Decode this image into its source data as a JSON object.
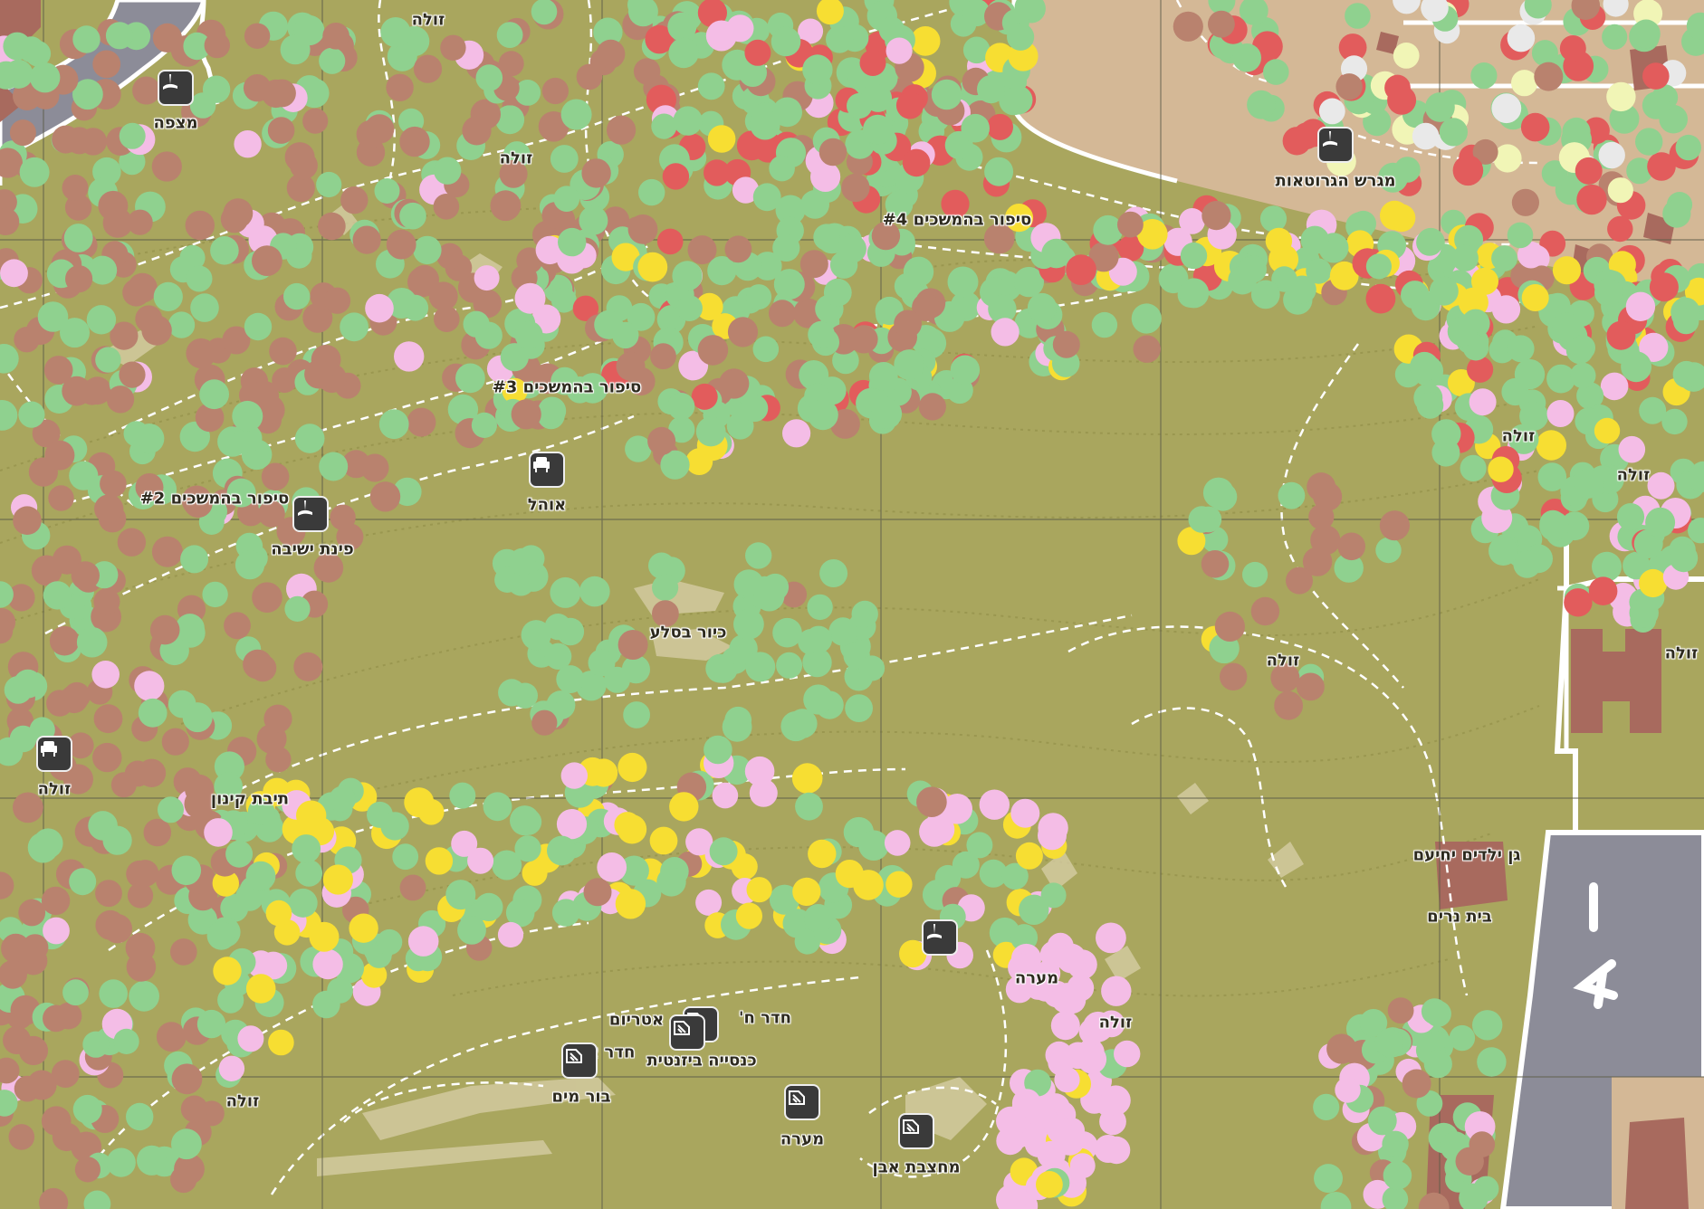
{
  "map": {
    "labels": [
      {
        "id": "zula-1",
        "text": "זולה"
      },
      {
        "id": "mitspe",
        "text": "מצפה"
      },
      {
        "id": "zula-2",
        "text": "זולה"
      },
      {
        "id": "sipur4",
        "text": "סיפור בהמשכים #4"
      },
      {
        "id": "grotaot",
        "text": "מגרש הגרוטאות"
      },
      {
        "id": "sipur3",
        "text": "סיפור בהמשכים #3"
      },
      {
        "id": "ohel",
        "text": "אוהל"
      },
      {
        "id": "sipur2",
        "text": "סיפור בהמשכים #2"
      },
      {
        "id": "pinat",
        "text": "פינת ישיבה"
      },
      {
        "id": "kiyor",
        "text": "כיור בסלע"
      },
      {
        "id": "zula-3",
        "text": "זולה"
      },
      {
        "id": "zula-4",
        "text": "זולה"
      },
      {
        "id": "zula-5",
        "text": "זולה"
      },
      {
        "id": "zula-6",
        "text": "זולה"
      },
      {
        "id": "zula-7",
        "text": "זולה"
      },
      {
        "id": "teivat",
        "text": "תיבת קינון"
      },
      {
        "id": "gan",
        "text": "גן ילדים יחיעם"
      },
      {
        "id": "beit",
        "text": "בית נרים"
      },
      {
        "id": "meara-1",
        "text": "מערה"
      },
      {
        "id": "zula-8",
        "text": "זולה"
      },
      {
        "id": "heder-het",
        "text": "חדר ח'"
      },
      {
        "id": "atrium",
        "text": "אטריום"
      },
      {
        "id": "heder-alef",
        "text": "חדר א'"
      },
      {
        "id": "knesia",
        "text": "כנסייה ביזנטית"
      },
      {
        "id": "bor",
        "text": "בור מים"
      },
      {
        "id": "meara-2",
        "text": "מערה"
      },
      {
        "id": "mahtsevet",
        "text": "מחצבת אבן"
      },
      {
        "id": "zula-9",
        "text": "זולה"
      }
    ],
    "icons": [
      {
        "id": "seat-mitspe",
        "icon": "lounge-chair-icon"
      },
      {
        "id": "seat-pinat",
        "icon": "lounge-chair-icon"
      },
      {
        "id": "seat-grotaot",
        "icon": "lounge-chair-icon"
      },
      {
        "id": "seat-center",
        "icon": "lounge-chair-icon"
      },
      {
        "id": "armchair-ohel",
        "icon": "armchair-icon"
      },
      {
        "id": "armchair-zula",
        "icon": "armchair-icon"
      },
      {
        "id": "ruin-heder",
        "icon": "ruin-icon"
      },
      {
        "id": "ruin-knesia",
        "icon": "ruin-icon"
      },
      {
        "id": "ruin-heder-alef",
        "icon": "ruin-icon"
      },
      {
        "id": "ruin-meara",
        "icon": "ruin-icon"
      },
      {
        "id": "ruin-mahtsevet",
        "icon": "ruin-icon"
      }
    ],
    "colors": {
      "terrain": "#a9a65e",
      "residential": "#d4b896",
      "road": "#8c8c98",
      "building": "#a86a5e",
      "tree_green": "#8fd18f",
      "tree_brown": "#b9826e",
      "tree_red": "#e25c5c",
      "tree_yellow": "#f7de32",
      "tree_pink": "#f4bde6",
      "tree_white": "#e9e9e9",
      "tree_cream": "#f1f5b6"
    },
    "road_marking": "A"
  }
}
